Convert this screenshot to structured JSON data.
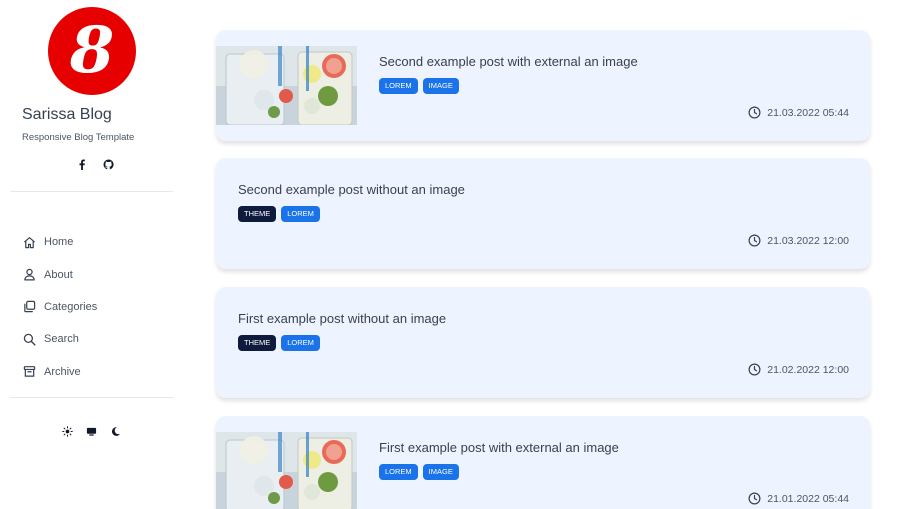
{
  "blog": {
    "logo_letter": "8",
    "title": "Sarissa Blog",
    "subtitle": "Responsive Blog Template",
    "social": [
      "facebook-icon",
      "github-icon"
    ]
  },
  "nav": [
    {
      "label": "Home",
      "icon": "home-icon"
    },
    {
      "label": "About",
      "icon": "user-icon"
    },
    {
      "label": "Categories",
      "icon": "categories-icon"
    },
    {
      "label": "Search",
      "icon": "search-icon"
    },
    {
      "label": "Archive",
      "icon": "archive-icon"
    }
  ],
  "theme_switch": [
    "sun-icon",
    "monitor-icon",
    "moon-icon"
  ],
  "posts": [
    {
      "title": "Second example post with external an image",
      "tags": [
        "LOREM",
        "IMAGE"
      ],
      "date": "21.03.2022 05:44",
      "has_image": true
    },
    {
      "title": "Second example post without an image",
      "tags": [
        "THEME",
        "LOREM"
      ],
      "date": "21.03.2022 12:00",
      "has_image": false
    },
    {
      "title": "First example post without an image",
      "tags": [
        "THEME",
        "LOREM"
      ],
      "date": "21.02.2022 12:00",
      "has_image": false
    },
    {
      "title": "First example post with external an image",
      "tags": [
        "LOREM",
        "IMAGE"
      ],
      "date": "21.01.2022 05:44",
      "has_image": true
    }
  ],
  "colors": {
    "logo_bg": "#e60000",
    "card_bg": "#eef4ff",
    "tag_blue": "#1a73e8",
    "tag_dark": "#0f1b3d"
  }
}
